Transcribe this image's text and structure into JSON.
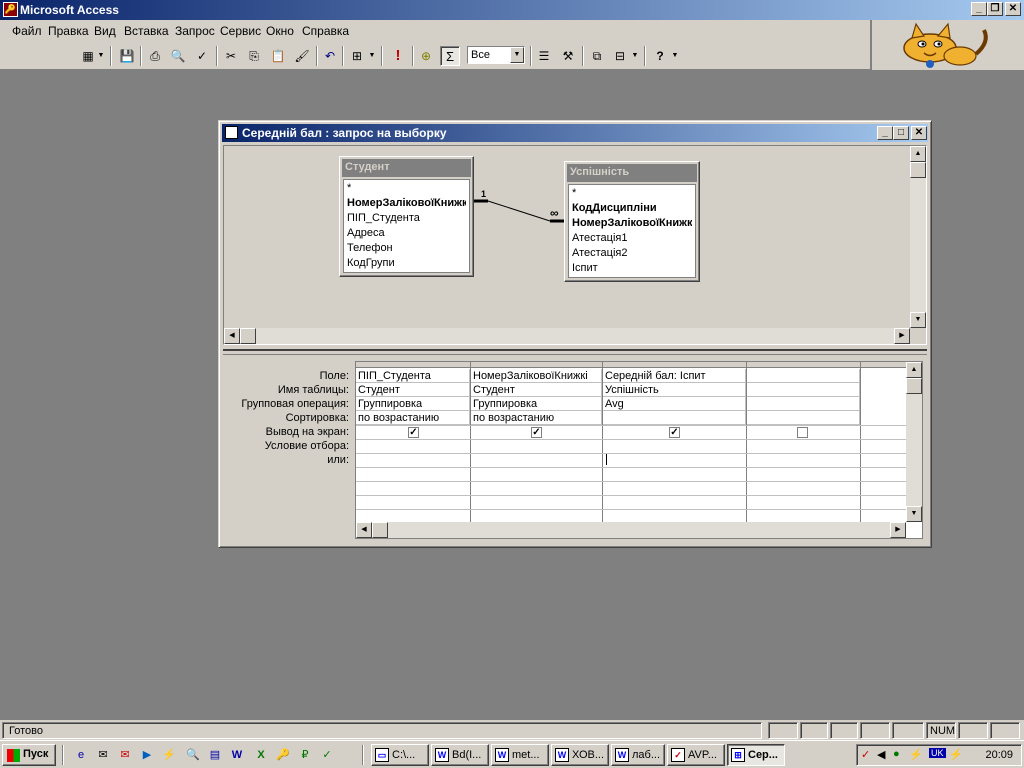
{
  "app": {
    "title": "Microsoft Access",
    "icon": "access-key-icon"
  },
  "menu": [
    "Файл",
    "Правка",
    "Вид",
    "Вставка",
    "Запрос",
    "Сервис",
    "Окно",
    "Справка"
  ],
  "toolbar": {
    "buttons": [
      "view-icon",
      "save-icon",
      "print-icon",
      "print-preview-icon",
      "spellcheck-icon",
      "cut-icon",
      "copy-icon",
      "paste-icon",
      "format-painter-icon",
      "undo-icon",
      "query-type-icon",
      "run-icon",
      "show-table-icon",
      "totals-icon",
      "properties-icon",
      "build-icon",
      "database-window-icon",
      "new-object-icon",
      "help-icon"
    ],
    "run_symbol": "!",
    "totals_symbol": "Σ",
    "top_values": "Все"
  },
  "query_window": {
    "title": "Середній бал : запрос на выборку",
    "tables": [
      {
        "name": "Студент",
        "fields": [
          {
            "text": "*",
            "key": false
          },
          {
            "text": "НомерЗаліковоїКнижки",
            "key": true
          },
          {
            "text": "ПІП_Студента",
            "key": false
          },
          {
            "text": "Адреса",
            "key": false
          },
          {
            "text": "Телефон",
            "key": false
          },
          {
            "text": "КодГрупи",
            "key": false
          }
        ]
      },
      {
        "name": "Успішність",
        "fields": [
          {
            "text": "*",
            "key": false
          },
          {
            "text": "КодДисципліни",
            "key": true
          },
          {
            "text": "НомерЗаліковоїКнижки",
            "key": true
          },
          {
            "text": "Атестація1",
            "key": false
          },
          {
            "text": "Атестація2",
            "key": false
          },
          {
            "text": "Іспит",
            "key": false
          }
        ]
      }
    ],
    "relation": {
      "one": "1",
      "many": "∞"
    },
    "grid": {
      "row_labels": [
        "Поле:",
        "Имя таблицы:",
        "Групповая операция:",
        "Сортировка:",
        "Вывод на экран:",
        "Условие отбора:",
        "или:"
      ],
      "columns": [
        {
          "field": "ПІП_Студента",
          "table": "Студент",
          "group": "Группировка",
          "sort": "по возрастанию",
          "show": true
        },
        {
          "field": "НомерЗаліковоїКнижкі",
          "table": "Студент",
          "group": "Группировка",
          "sort": "по возрастанию",
          "show": true
        },
        {
          "field": "Середній бал: Іспит",
          "table": "Успішність",
          "group": "Avg",
          "sort": "",
          "show": true
        },
        {
          "field": "",
          "table": "",
          "group": "",
          "sort": "",
          "show": false
        }
      ]
    }
  },
  "status": {
    "text": "Готово",
    "num": "NUM"
  },
  "taskbar": {
    "start": "Пуск",
    "tasks": [
      {
        "label": "C:\\...",
        "icon": "folder-icon"
      },
      {
        "label": "Bd(I...",
        "icon": "word-icon"
      },
      {
        "label": "met...",
        "icon": "word-icon"
      },
      {
        "label": "ХОВ...",
        "icon": "word-icon"
      },
      {
        "label": "лаб...",
        "icon": "word-icon"
      },
      {
        "label": "AVP...",
        "icon": "antivirus-icon"
      },
      {
        "label": "Сер...",
        "icon": "query-icon"
      }
    ],
    "tray_lang": "UK",
    "clock": "20:09"
  }
}
